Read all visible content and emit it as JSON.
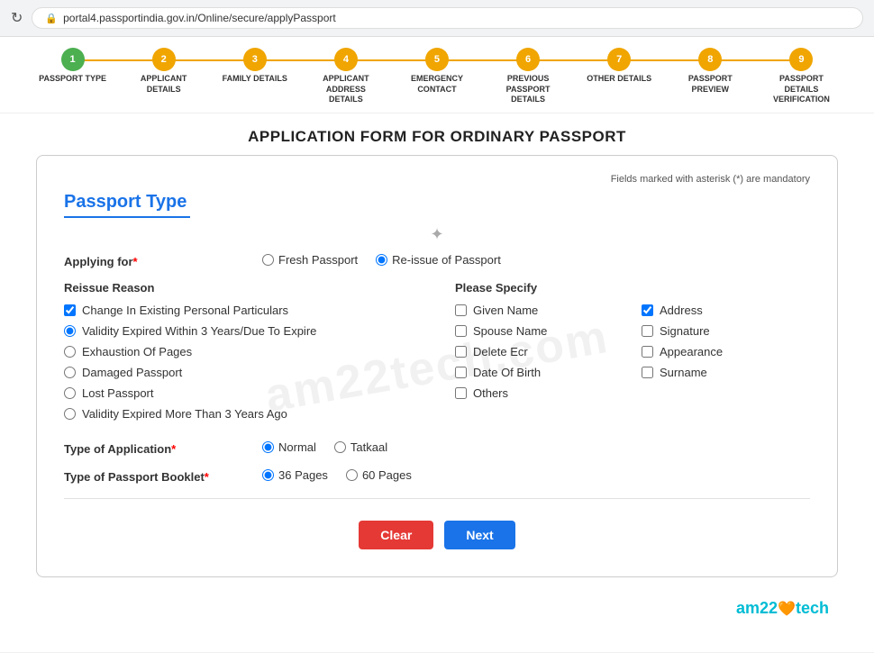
{
  "browser": {
    "url": "portal4.passportindia.gov.in/Online/secure/applyPassport",
    "refresh_title": "Refresh"
  },
  "stepper": {
    "steps": [
      {
        "id": 1,
        "label": "PASSPORT TYPE",
        "state": "active"
      },
      {
        "id": 2,
        "label": "APPLICANT DETAILS",
        "state": "pending"
      },
      {
        "id": 3,
        "label": "FAMILY DETAILS",
        "state": "pending"
      },
      {
        "id": 4,
        "label": "APPLICANT ADDRESS DETAILS",
        "state": "pending"
      },
      {
        "id": 5,
        "label": "EMERGENCY CONTACT",
        "state": "pending"
      },
      {
        "id": 6,
        "label": "PREVIOUS PASSPORT DETAILS",
        "state": "pending"
      },
      {
        "id": 7,
        "label": "OTHER DETAILS",
        "state": "pending"
      },
      {
        "id": 8,
        "label": "PASSPORT PREVIEW",
        "state": "pending"
      },
      {
        "id": 9,
        "label": "PASSPORT DETAILS VERIFICATION",
        "state": "pending"
      }
    ]
  },
  "page": {
    "main_heading": "APPLICATION FORM FOR ORDINARY PASSPORT",
    "mandatory_note": "Fields marked with asterisk (*) are mandatory"
  },
  "form": {
    "section_title": "Passport Type",
    "applying_for_label": "Applying for",
    "applying_for_options": [
      {
        "id": "fresh",
        "label": "Fresh Passport",
        "checked": false
      },
      {
        "id": "reissue",
        "label": "Re-issue of Passport",
        "checked": true
      }
    ],
    "reissue_reason": {
      "title": "Reissue Reason",
      "options": [
        {
          "id": "change_particulars",
          "label": "Change In Existing Personal Particulars",
          "checked": true
        },
        {
          "id": "validity_expired_3",
          "label": "Validity Expired Within 3 Years/Due To Expire",
          "checked": true
        },
        {
          "id": "exhaustion",
          "label": "Exhaustion Of Pages",
          "checked": false
        },
        {
          "id": "damaged",
          "label": "Damaged Passport",
          "checked": false
        },
        {
          "id": "lost",
          "label": "Lost Passport",
          "checked": false
        },
        {
          "id": "validity_expired_more",
          "label": "Validity Expired More Than 3 Years Ago",
          "checked": false
        }
      ]
    },
    "please_specify": {
      "title": "Please Specify",
      "options": [
        {
          "id": "given_name",
          "label": "Given Name",
          "checked": false
        },
        {
          "id": "address",
          "label": "Address",
          "checked": true
        },
        {
          "id": "spouse_name",
          "label": "Spouse Name",
          "checked": false
        },
        {
          "id": "signature",
          "label": "Signature",
          "checked": false
        },
        {
          "id": "delete_ecr",
          "label": "Delete Ecr",
          "checked": false
        },
        {
          "id": "appearance",
          "label": "Appearance",
          "checked": false
        },
        {
          "id": "date_of_birth",
          "label": "Date Of Birth",
          "checked": false
        },
        {
          "id": "surname",
          "label": "Surname",
          "checked": false
        },
        {
          "id": "others",
          "label": "Others",
          "checked": false
        }
      ]
    },
    "type_of_application": {
      "label": "Type of Application",
      "options": [
        {
          "id": "normal",
          "label": "Normal",
          "checked": true
        },
        {
          "id": "tatkaal",
          "label": "Tatkaal",
          "checked": false
        }
      ]
    },
    "type_of_booklet": {
      "label": "Type of Passport Booklet",
      "options": [
        {
          "id": "36pages",
          "label": "36 Pages",
          "checked": true
        },
        {
          "id": "60pages",
          "label": "60 Pages",
          "checked": false
        }
      ]
    },
    "buttons": {
      "clear": "Clear",
      "next": "Next"
    }
  },
  "watermark": "am22tech.com",
  "brand": "am22tech"
}
